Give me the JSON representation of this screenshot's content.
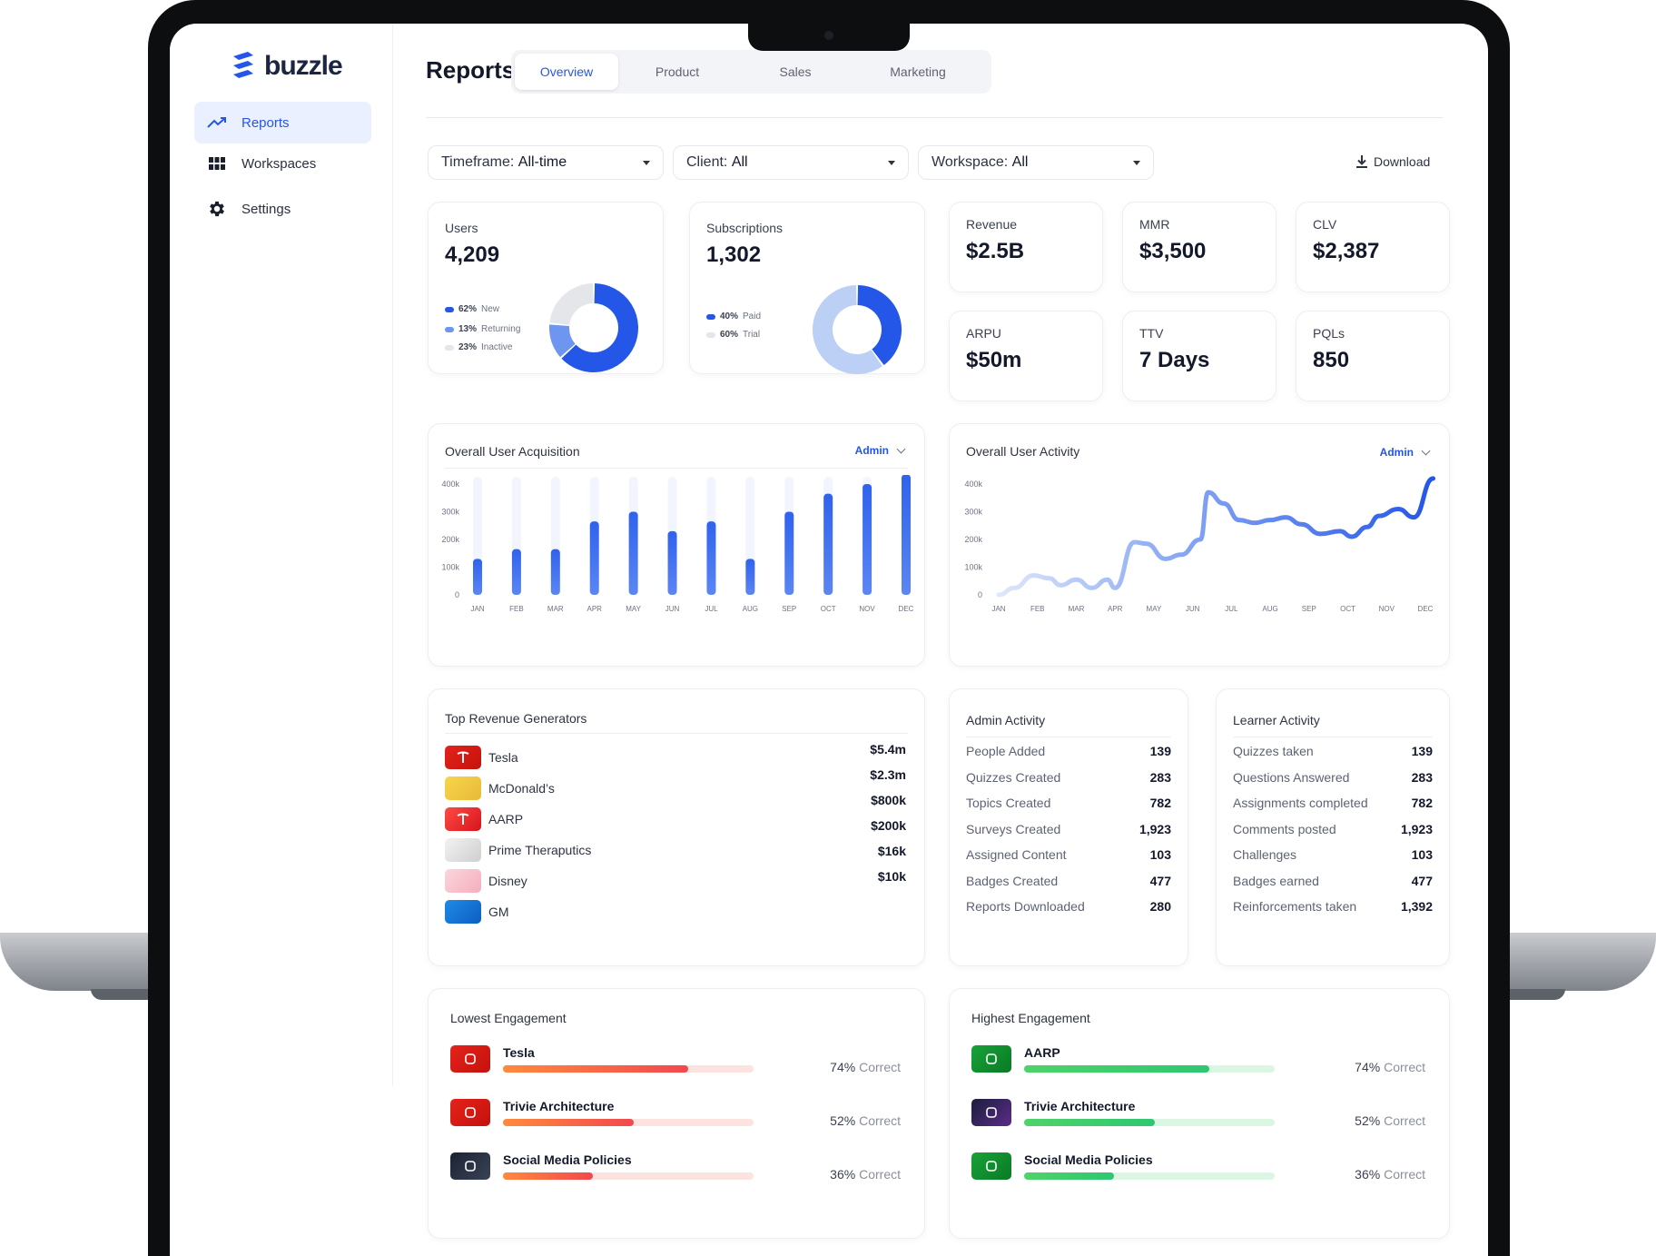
{
  "brand": {
    "name": "buzzle",
    "accent": "#2456e8"
  },
  "sidebar": {
    "items": [
      {
        "label": "Reports",
        "icon": "trend-up-icon",
        "active": true
      },
      {
        "label": "Workspaces",
        "icon": "grid-icon",
        "active": false
      },
      {
        "label": "Settings",
        "icon": "gear-icon",
        "active": false
      }
    ]
  },
  "header": {
    "title": "Reports",
    "tabs": [
      {
        "label": "Overview",
        "active": true
      },
      {
        "label": "Product",
        "active": false
      },
      {
        "label": "Sales",
        "active": false
      },
      {
        "label": "Marketing",
        "active": false
      }
    ]
  },
  "filters": {
    "timeframe": {
      "label": "Timeframe:",
      "value": "All-time"
    },
    "client": {
      "label": "Client:",
      "value": "All"
    },
    "workspace": {
      "label": "Workspace:",
      "value": "All"
    },
    "download_label": "Download"
  },
  "kpis": {
    "users": {
      "label": "Users",
      "value": "4,209",
      "legend": [
        {
          "pct": "62%",
          "label": "New",
          "color": "#2456e8",
          "share": 62
        },
        {
          "pct": "13%",
          "label": "Returning",
          "color": "#6e95ef",
          "share": 13
        },
        {
          "pct": "23%",
          "label": "Inactive",
          "color": "#e4e6ea",
          "share": 23
        }
      ]
    },
    "subscriptions": {
      "label": "Subscriptions",
      "value": "1,302",
      "legend": [
        {
          "pct": "40%",
          "label": "Paid",
          "color": "#2456e8",
          "share": 40
        },
        {
          "pct": "60%",
          "label": "Trial",
          "color": "#bcd0f6",
          "share": 60
        }
      ]
    },
    "tiles": [
      {
        "label": "Revenue",
        "value": "$2.5B"
      },
      {
        "label": "MMR",
        "value": "$3,500"
      },
      {
        "label": "CLV",
        "value": "$2,387"
      },
      {
        "label": "ARPU",
        "value": "$50m"
      },
      {
        "label": "TTV",
        "value": "7 Days"
      },
      {
        "label": "PQLs",
        "value": "850"
      }
    ]
  },
  "acquisition": {
    "title": "Overall User Acquisition",
    "selector": "Admin"
  },
  "activity": {
    "title": "Overall User Activity",
    "selector": "Admin"
  },
  "chart_data": [
    {
      "type": "bar",
      "title": "Overall User Acquisition",
      "categories": [
        "JAN",
        "FEB",
        "MAR",
        "APR",
        "MAY",
        "JUN",
        "JUL",
        "AUG",
        "SEP",
        "OCT",
        "NOV",
        "DEC"
      ],
      "values": [
        130000,
        165000,
        165000,
        265000,
        300000,
        230000,
        265000,
        130000,
        300000,
        365000,
        400000,
        435000
      ],
      "ylim": [
        0,
        400000
      ],
      "yticks": [
        "0",
        "100k",
        "200k",
        "300k",
        "400k"
      ],
      "xlabel": "",
      "ylabel": "",
      "color": "#2f62ee"
    },
    {
      "type": "line",
      "title": "Overall User Activity",
      "categories": [
        "JAN",
        "FEB",
        "MAR",
        "APR",
        "MAY",
        "JUN",
        "JUL",
        "AUG",
        "SEP",
        "OCT",
        "NOV",
        "DEC"
      ],
      "x": [
        0,
        0.4,
        0.9,
        1.3,
        1.6,
        2.0,
        2.4,
        2.8,
        3.0,
        3.5,
        3.8,
        4.3,
        4.7,
        5.2,
        5.4,
        5.8,
        6.2,
        6.6,
        7.0,
        7.4,
        7.8,
        8.3,
        8.8,
        9.1,
        9.5,
        9.8,
        10.3,
        10.7,
        11.2
      ],
      "y": [
        0,
        25000,
        70000,
        60000,
        35000,
        55000,
        25000,
        55000,
        25000,
        190000,
        185000,
        130000,
        145000,
        200000,
        370000,
        330000,
        270000,
        260000,
        270000,
        280000,
        255000,
        220000,
        230000,
        210000,
        245000,
        285000,
        310000,
        280000,
        420000
      ],
      "ylim": [
        0,
        400000
      ],
      "yticks": [
        "0",
        "100k",
        "200k",
        "300k",
        "400k"
      ],
      "xlabel": "",
      "ylabel": "",
      "color": "#2f62ee"
    }
  ],
  "revenue": {
    "title": "Top Revenue Generators",
    "rows": [
      {
        "name": "Tesla",
        "value": "$5.4m",
        "logo": "tesla-logo-icon"
      },
      {
        "name": "McDonald’s",
        "value": "$2.3m",
        "logo": "mcdonalds-logo-icon"
      },
      {
        "name": "AARP",
        "value": "$800k",
        "logo": "aarp-logo-icon"
      },
      {
        "name": "Prime Theraputics",
        "value": "$200k",
        "logo": "prime-logo-icon"
      },
      {
        "name": "Disney",
        "value": "$16k",
        "logo": "disney-logo-icon"
      },
      {
        "name": "GM",
        "value": "$10k",
        "logo": "gm-logo-icon"
      }
    ]
  },
  "admin_activity": {
    "title": "Admin Activity",
    "rows": [
      {
        "label": "People Added",
        "value": "139"
      },
      {
        "label": "Quizzes Created",
        "value": "283"
      },
      {
        "label": "Topics Created",
        "value": "782"
      },
      {
        "label": "Surveys Created",
        "value": "1,923"
      },
      {
        "label": "Assigned Content",
        "value": "103"
      },
      {
        "label": "Badges Created",
        "value": "477"
      },
      {
        "label": "Reports Downloaded",
        "value": "280"
      }
    ]
  },
  "learner_activity": {
    "title": "Learner Activity",
    "rows": [
      {
        "label": "Quizzes taken",
        "value": "139"
      },
      {
        "label": "Questions Answered",
        "value": "283"
      },
      {
        "label": "Assignments completed",
        "value": "782"
      },
      {
        "label": "Comments posted",
        "value": "1,923"
      },
      {
        "label": "Challenges",
        "value": "103"
      },
      {
        "label": "Badges earned",
        "value": "477"
      },
      {
        "label": "Reinforcements taken",
        "value": "1,392"
      }
    ]
  },
  "lowest": {
    "title": "Lowest Engagement",
    "suffix": "Correct",
    "rows": [
      {
        "name": "Tesla",
        "pct": "74%",
        "progress": 0.74
      },
      {
        "name": "Trivie Architecture",
        "pct": "52%",
        "progress": 0.52
      },
      {
        "name": "Social Media Policies",
        "pct": "36%",
        "progress": 0.36
      }
    ]
  },
  "highest": {
    "title": "Highest Engagement",
    "suffix": "Correct",
    "rows": [
      {
        "name": "AARP",
        "pct": "74%",
        "progress": 0.74
      },
      {
        "name": "Trivie Architecture",
        "pct": "52%",
        "progress": 0.52
      },
      {
        "name": "Social Media Policies",
        "pct": "36%",
        "progress": 0.36
      }
    ]
  }
}
